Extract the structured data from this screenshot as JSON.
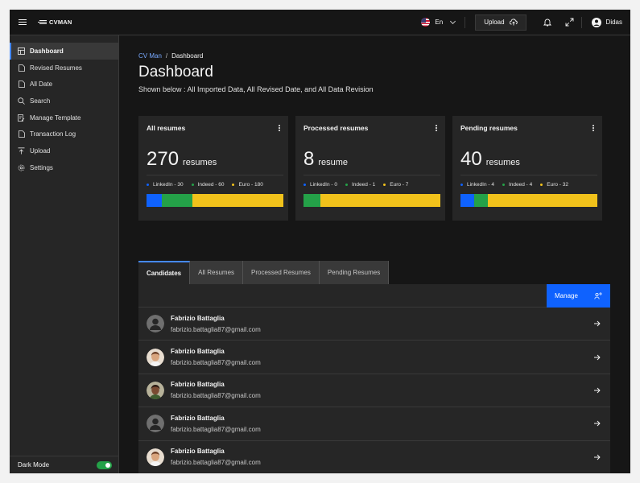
{
  "header": {
    "app_name": "CVMAN",
    "language": "En",
    "upload_label": "Upload",
    "user_name": "Didas"
  },
  "sidebar": {
    "items": [
      {
        "label": "Dashboard",
        "icon": "dashboard-icon",
        "active": true
      },
      {
        "label": "Revised Resumes",
        "icon": "document-icon"
      },
      {
        "label": "All Date",
        "icon": "document-icon"
      },
      {
        "label": "Search",
        "icon": "search-icon"
      },
      {
        "label": "Manage Template",
        "icon": "template-icon"
      },
      {
        "label": "Transaction Log",
        "icon": "document-icon"
      },
      {
        "label": "Upload",
        "icon": "upload-icon"
      },
      {
        "label": "Settings",
        "icon": "gear-icon"
      }
    ],
    "dark_mode_label": "Dark Mode",
    "dark_mode_on": true
  },
  "breadcrumb": {
    "root": "CV Man",
    "separator": "/",
    "current": "Dashboard"
  },
  "page": {
    "title": "Dashboard",
    "subtitle": "Shown below : All Imported Data, All Revised Date, and All Data Revision"
  },
  "colors": {
    "linkedin": "#0f62fe",
    "indeed": "#24a148",
    "euro": "#f1c21b"
  },
  "cards": [
    {
      "title": "All resumes",
      "count": "270",
      "unit": "resumes",
      "legend": [
        "LinkedIn - 30",
        "Indeed - 60",
        "Euro - 180"
      ],
      "values": [
        30,
        60,
        180
      ]
    },
    {
      "title": "Processed resumes",
      "count": "8",
      "unit": "resume",
      "legend": [
        "LinkedIn - 0",
        "Indeed - 1",
        "Euro - 7"
      ],
      "values": [
        0,
        1,
        7
      ]
    },
    {
      "title": "Pending resumes",
      "count": "40",
      "unit": "resumes",
      "legend": [
        "LinkedIn - 4",
        "Indeed - 4",
        "Euro - 32"
      ],
      "values": [
        4,
        4,
        32
      ]
    }
  ],
  "tabs": [
    "Candidates",
    "All Resumes",
    "Processed Resumes",
    "Pending Resumes"
  ],
  "panel": {
    "manage_label": "Manage"
  },
  "candidates": [
    {
      "name": "Fabrizio Battaglia",
      "email": "fabrizio.battaglia87@gmail.com",
      "avatar": "placeholder"
    },
    {
      "name": "Fabrizio Battaglia",
      "email": "fabrizio.battaglia87@gmail.com",
      "avatar": "photo-light"
    },
    {
      "name": "Fabrizio Battaglia",
      "email": "fabrizio.battaglia87@gmail.com",
      "avatar": "photo-dark"
    },
    {
      "name": "Fabrizio Battaglia",
      "email": "fabrizio.battaglia87@gmail.com",
      "avatar": "placeholder"
    },
    {
      "name": "Fabrizio Battaglia",
      "email": "fabrizio.battaglia87@gmail.com",
      "avatar": "photo-light"
    }
  ]
}
